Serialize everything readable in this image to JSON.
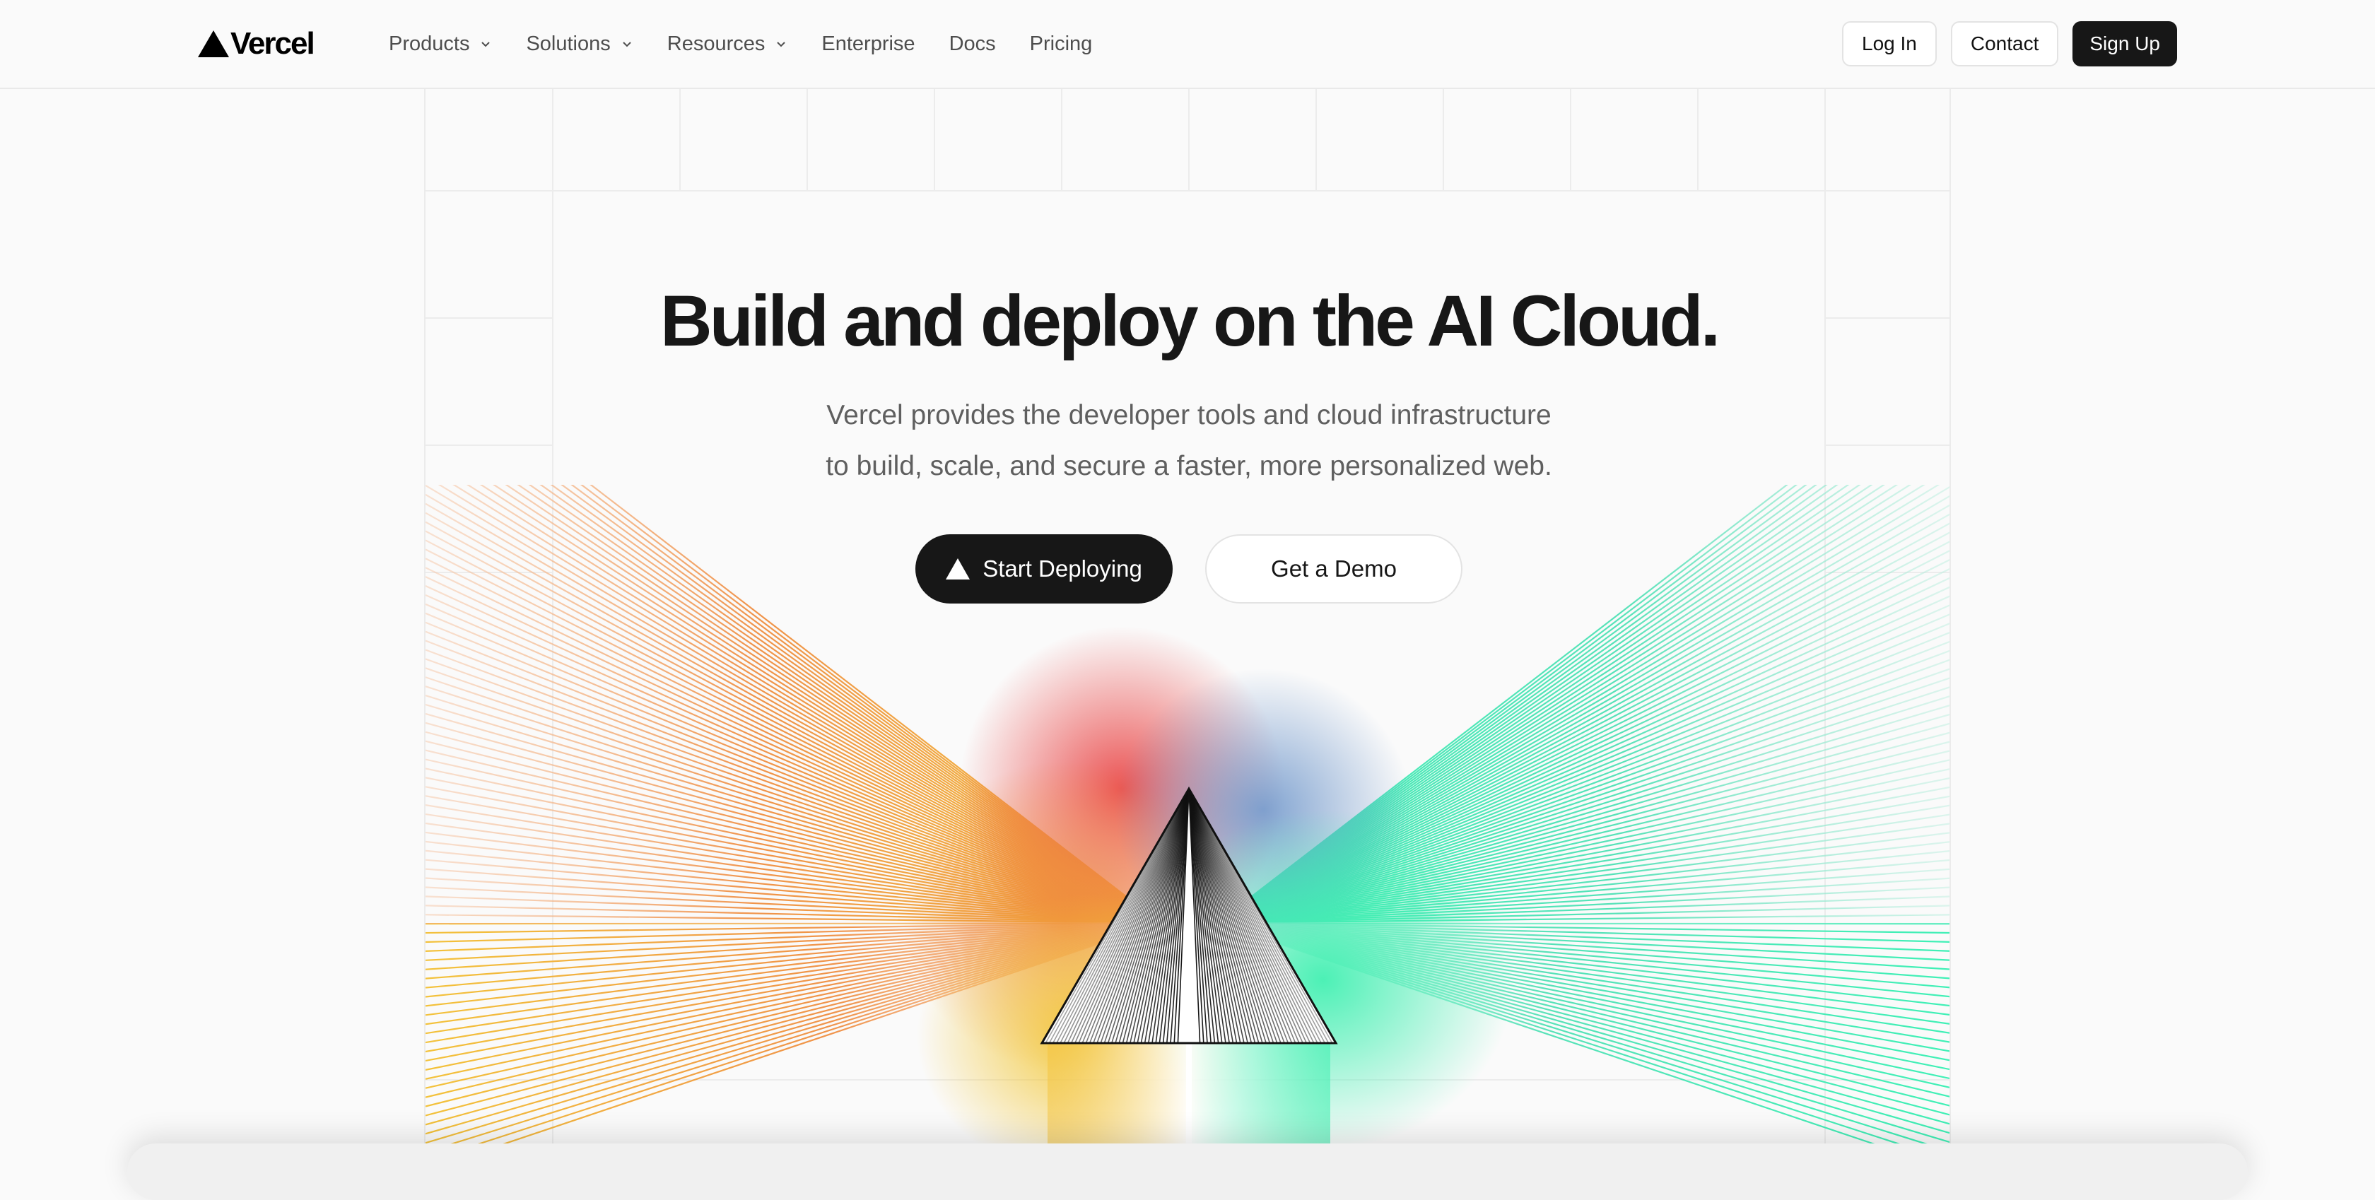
{
  "header": {
    "logo_text": "Vercel",
    "nav": [
      {
        "label": "Products",
        "has_dropdown": true
      },
      {
        "label": "Solutions",
        "has_dropdown": true
      },
      {
        "label": "Resources",
        "has_dropdown": true
      },
      {
        "label": "Enterprise",
        "has_dropdown": false
      },
      {
        "label": "Docs",
        "has_dropdown": false
      },
      {
        "label": "Pricing",
        "has_dropdown": false
      }
    ],
    "login_label": "Log In",
    "contact_label": "Contact",
    "signup_label": "Sign Up"
  },
  "hero": {
    "title": "Build and deploy on the AI Cloud.",
    "subtitle_line1": "Vercel provides the developer tools and cloud infrastructure",
    "subtitle_line2": "to build, scale, and secure a faster, more personalized web.",
    "primary_cta": "Start Deploying",
    "secondary_cta": "Get a Demo"
  },
  "colors": {
    "background": "#fafafa",
    "text_primary": "#171717",
    "text_secondary": "#5f5f5f",
    "button_dark": "#171717",
    "gradient_orange": "#f29a3c",
    "gradient_red": "#e94b4b",
    "gradient_yellow": "#f2c530",
    "gradient_blue": "#6a93c9",
    "gradient_green": "#4ef0b0"
  },
  "icons": {
    "logo": "vercel-triangle-icon",
    "nav_dropdown": "chevron-down-icon",
    "cta": "triangle-icon"
  }
}
